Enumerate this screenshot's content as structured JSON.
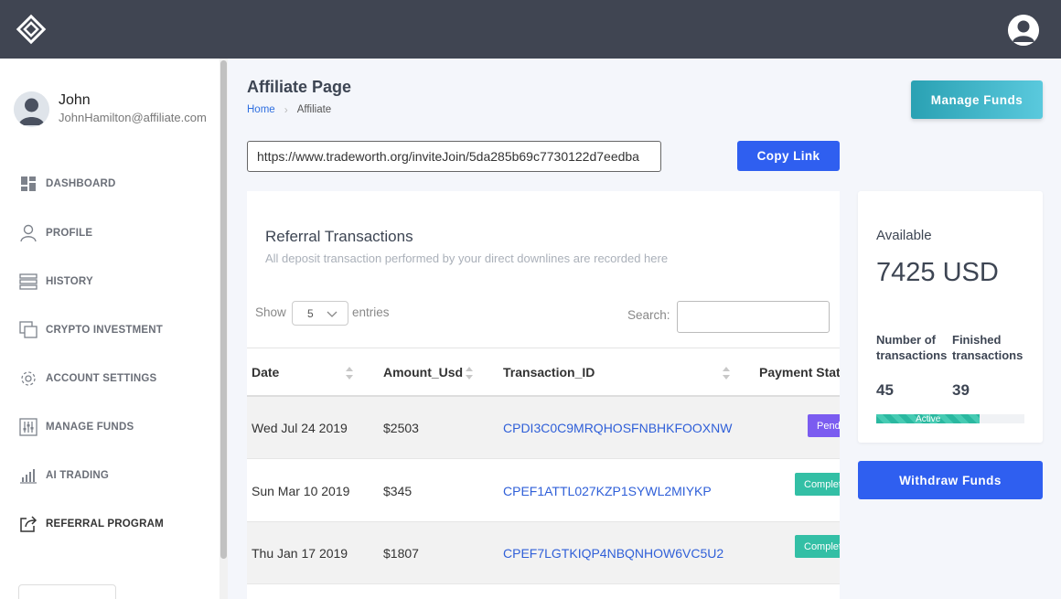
{
  "header": {
    "logo_icon": "diamond-logo-icon",
    "avatar_icon": "user-avatar-icon"
  },
  "sidebar": {
    "user": {
      "name": "John",
      "email": "JohnHamilton@affiliate.com"
    },
    "items": [
      {
        "label": "DASHBOARD",
        "icon": "dashboard-icon"
      },
      {
        "label": "PROFILE",
        "icon": "user-icon"
      },
      {
        "label": "HISTORY",
        "icon": "history-icon"
      },
      {
        "label": "CRYPTO INVESTMENT",
        "icon": "copy-icon"
      },
      {
        "label": "ACCOUNT SETTINGS",
        "icon": "gear-icon"
      },
      {
        "label": "MANAGE FUNDS",
        "icon": "sliders-icon"
      },
      {
        "label": "AI TRADING",
        "icon": "bar-chart-icon"
      },
      {
        "label": "REFERRAL PROGRAM",
        "icon": "share-icon"
      }
    ]
  },
  "page": {
    "title": "Affiliate Page",
    "breadcrumb": {
      "home": "Home",
      "current": "Affiliate"
    },
    "manage_funds_label": "Manage Funds",
    "invite_link": "https://www.tradeworth.org/inviteJoin/5da285b69c7730122d7eedba",
    "copy_link_label": "Copy Link"
  },
  "referral": {
    "title": "Referral Transactions",
    "subtitle": "All deposit transaction performed by your direct downlines are recorded here",
    "show_label": "Show",
    "show_value": "5",
    "entries_label": "entries",
    "search_label": "Search:",
    "columns": [
      "Date",
      "Amount_Usd",
      "Transaction_ID",
      "Payment Stat"
    ],
    "rows": [
      {
        "date": "Wed Jul 24 2019",
        "amount": "$2503",
        "txid": "CPDI3C0C9MRQHOSFNBHKFOOXNW",
        "status": "Pending",
        "status_color": "#7b5cf0"
      },
      {
        "date": "Sun Mar 10 2019",
        "amount": "$345",
        "txid": "CPEF1ATTL027KZP1SYWL2MIYKP",
        "status": "Complete",
        "status_color": "#33bfa5"
      },
      {
        "date": "Thu Jan 17 2019",
        "amount": "$1807",
        "txid": "CPEF7LGTKIQP4NBQNHOW6VC5U2",
        "status": "Complete",
        "status_color": "#33bfa5"
      }
    ]
  },
  "available": {
    "label": "Available",
    "value": "7425 USD",
    "num_tx_label_1": "Number of",
    "num_tx_label_2": "transactions",
    "fin_tx_label_1": "Finished",
    "fin_tx_label_2": "transactions",
    "num_tx": "45",
    "fin_tx": "39",
    "progress_label": "Active",
    "progress_fraction": 0.7
  },
  "withdraw_label": "Withdraw Funds"
}
